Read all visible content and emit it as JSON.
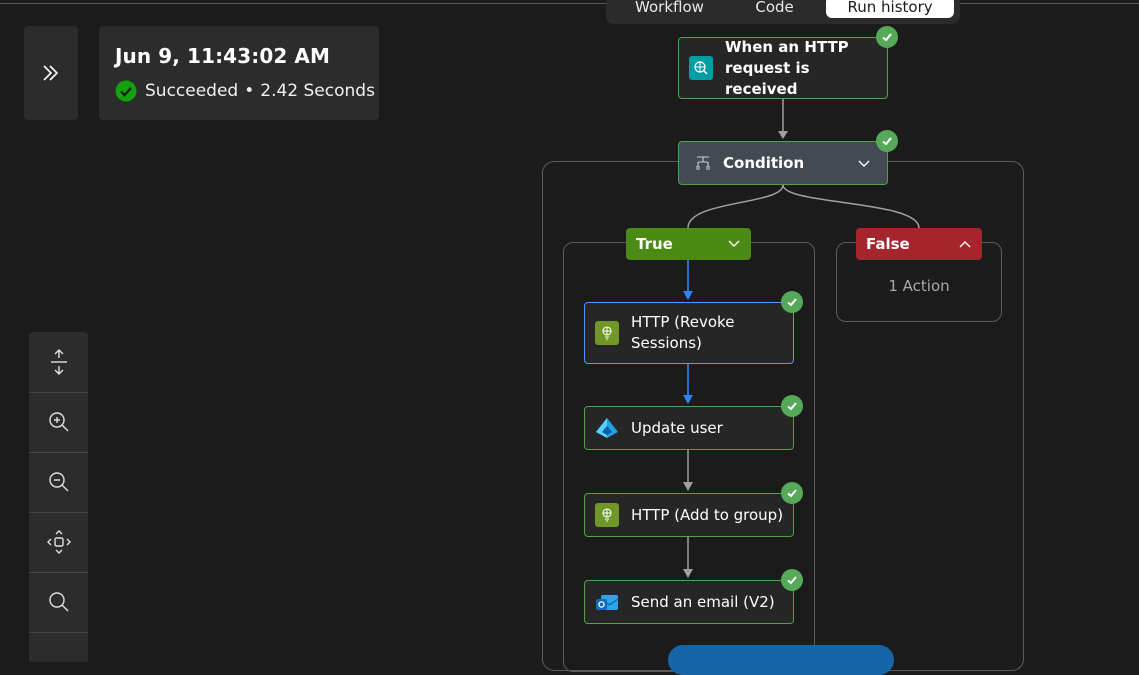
{
  "tabs": [
    "Workflow",
    "Code",
    "Run history"
  ],
  "run": {
    "date": "Jun 9, 11:43:02 AM",
    "status": "Succeeded",
    "separator": "•",
    "duration": "2.42 Seconds"
  },
  "toolbar": {
    "tools": [
      "fit-vertical-icon",
      "zoom-in-icon",
      "zoom-out-icon",
      "fit-view-icon",
      "search-icon"
    ]
  },
  "workflow": {
    "trigger": {
      "line1": "When an HTTP",
      "line2": "request is received",
      "status": "succeeded"
    },
    "condition": {
      "label": "Condition",
      "status": "succeeded"
    },
    "true_branch": {
      "label": "True"
    },
    "false_branch": {
      "label": "False",
      "summary": "1 Action"
    },
    "actions": [
      {
        "line1": "HTTP (Revoke",
        "line2": "Sessions)",
        "icon": "http-icon",
        "status": "succeeded"
      },
      {
        "line1": "Update user",
        "line2": "",
        "icon": "entra-id-icon",
        "status": "succeeded"
      },
      {
        "line1": "HTTP (Add to group)",
        "line2": "",
        "icon": "http-icon",
        "status": "succeeded"
      },
      {
        "line1": "Send an email (V2)",
        "line2": "",
        "icon": "outlook-icon",
        "status": "succeeded"
      }
    ]
  },
  "colors": {
    "success": "#57a95a",
    "true_branch": "#4b8a14",
    "false_branch": "#a4262c",
    "selected_border": "#4f9bff",
    "canvas": "#1b1b1b"
  }
}
